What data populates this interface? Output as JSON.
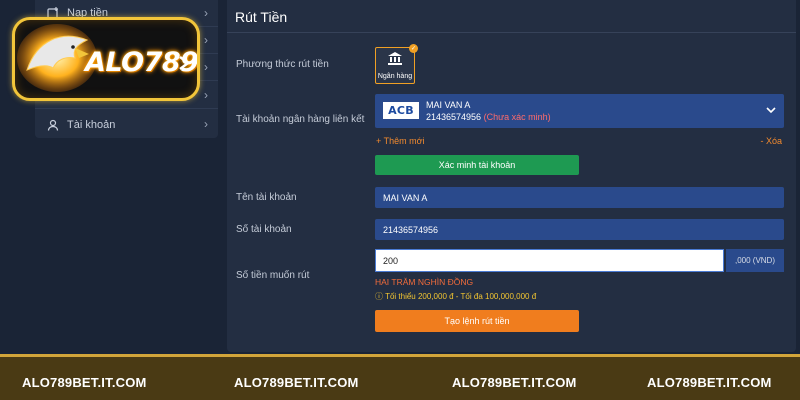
{
  "sidebar": {
    "items": [
      {
        "label": "Nạp tiền",
        "icon": "deposit-icon"
      },
      {
        "label": "",
        "icon": ""
      },
      {
        "label": "",
        "icon": ""
      },
      {
        "label": "",
        "icon": ""
      },
      {
        "label": "Tài khoản",
        "icon": "user-icon"
      }
    ]
  },
  "logo": {
    "text": "ALO789"
  },
  "panel": {
    "title": "Rút Tiền",
    "method_label": "Phương thức rút tiền",
    "method_option": "Ngân hàng",
    "linked_label": "Tài khoản ngân hàng liên kết",
    "bank": {
      "logo": "ACB",
      "account_name": "MAI VAN A",
      "account_number": "21436574956",
      "status": "(Chưa xác minh)"
    },
    "add_new": "+ Thêm mới",
    "delete": "- Xóa",
    "verify_button": "Xác minh tài khoản",
    "account_name_label": "Tên tài khoản",
    "account_name_value": "MAI VAN A",
    "account_number_label": "Số tài khoản",
    "account_number_value": "21436574956",
    "amount_label": "Số tiền muốn rút",
    "amount_value": "200",
    "amount_suffix": ",000 (VND)",
    "amount_words": "HAI TRĂM NGHÌN ĐỒNG",
    "limit_note": "ⓘ Tối thiểu 200,000 đ - Tối đa 100,000,000 đ",
    "submit_button": "Tạo lệnh rút tiền"
  },
  "footer": {
    "texts": [
      "ALO789BET.IT.COM",
      "ALO789BET.IT.COM",
      "ALO789BET.IT.COM",
      "ALO789BET.IT.COM"
    ]
  }
}
